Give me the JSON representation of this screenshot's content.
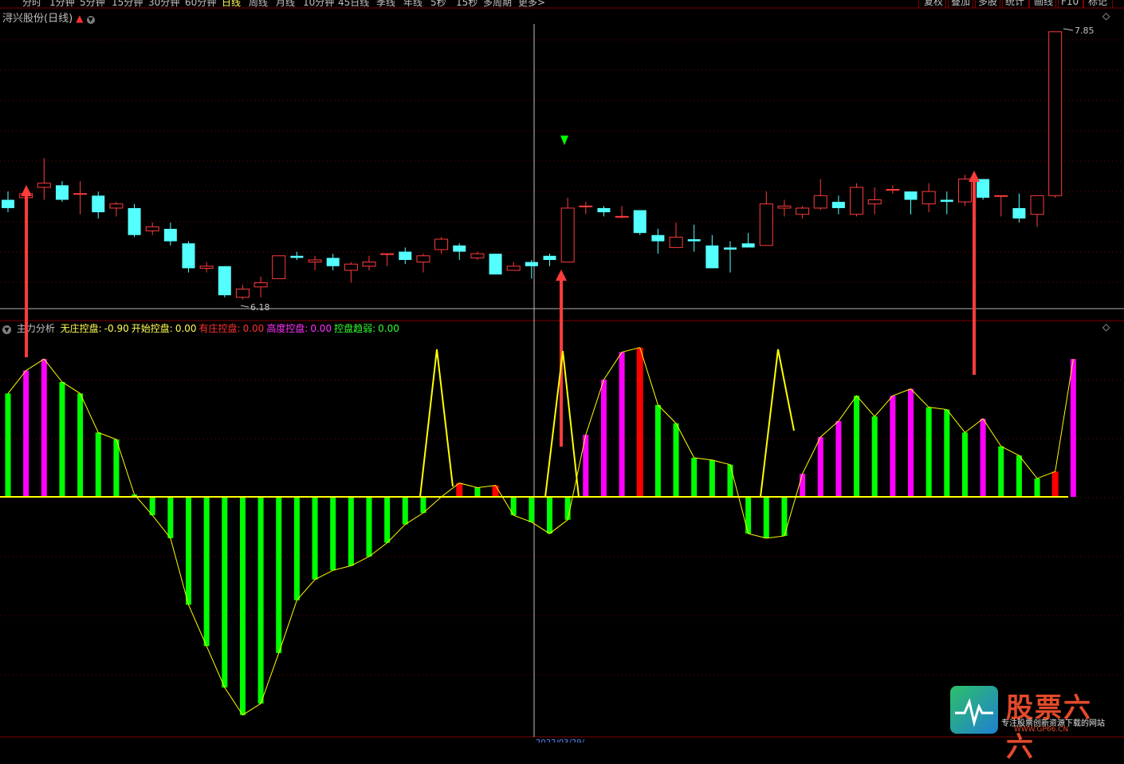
{
  "toolbar": {
    "periods": [
      "分时",
      "1分钟",
      "5分钟",
      "15分钟",
      "30分钟",
      "60分钟",
      "日线",
      "周线",
      "月线",
      "10分钟",
      "45日线",
      "季线",
      "年线",
      "5秒",
      "15秒",
      "多周期",
      "更多>"
    ],
    "active_period": "日线",
    "right_buttons": [
      "复权",
      "叠加",
      "多股",
      "统计",
      "画线",
      "F10",
      "标记"
    ]
  },
  "stock": {
    "title": "浔兴股份(日线)"
  },
  "price_labels": {
    "high": "7.85",
    "low": "6.18"
  },
  "indicator": {
    "name": "主力分析",
    "items": [
      {
        "label": "无庄控盘:",
        "value": "-0.90",
        "color": "#ffff54"
      },
      {
        "label": "开始控盘:",
        "value": "0.00",
        "color": "#ffff54"
      },
      {
        "label": "有庄控盘:",
        "value": "0.00",
        "color": "#ff3030"
      },
      {
        "label": "高度控盘:",
        "value": "0.00",
        "color": "#ff30ff"
      },
      {
        "label": "控盘趋弱:",
        "value": "0.00",
        "color": "#30ff30"
      }
    ]
  },
  "footer": {
    "date_label": "2022/03/29/"
  },
  "watermark": {
    "brand": "股票六六",
    "slogan": "专注股票创新资源下载的网站",
    "url": "WWW.GP66.CN"
  },
  "colors": {
    "up": "#ff3c3c",
    "down": "#54ffff",
    "green": "#00ff00",
    "magenta": "#ff00ff",
    "red_bar": "#ff0000",
    "yellow": "#ffff00"
  },
  "chart_data": [
    {
      "type": "candlestick",
      "ohlc": [
        [
          7.04,
          7.08,
          6.98,
          7.0
        ],
        [
          7.05,
          7.09,
          6.98,
          7.07
        ],
        [
          7.1,
          7.24,
          7.04,
          7.12
        ],
        [
          7.11,
          7.13,
          7.03,
          7.04
        ],
        [
          7.07,
          7.13,
          6.97,
          7.07
        ],
        [
          7.06,
          7.08,
          6.95,
          6.98
        ],
        [
          7.0,
          7.03,
          6.96,
          7.02
        ],
        [
          7.0,
          7.02,
          6.86,
          6.87
        ],
        [
          6.89,
          6.93,
          6.87,
          6.91
        ],
        [
          6.9,
          6.93,
          6.82,
          6.84
        ],
        [
          6.83,
          6.84,
          6.69,
          6.71
        ],
        [
          6.71,
          6.74,
          6.69,
          6.72
        ],
        [
          6.72,
          6.72,
          6.57,
          6.58
        ],
        [
          6.57,
          6.63,
          6.56,
          6.61
        ],
        [
          6.62,
          6.67,
          6.57,
          6.64
        ],
        [
          6.66,
          6.77,
          6.66,
          6.77
        ],
        [
          6.77,
          6.79,
          6.75,
          6.76
        ],
        [
          6.74,
          6.77,
          6.7,
          6.75
        ],
        [
          6.76,
          6.78,
          6.7,
          6.72
        ],
        [
          6.7,
          6.74,
          6.64,
          6.73
        ],
        [
          6.72,
          6.77,
          6.7,
          6.74
        ],
        [
          6.78,
          6.78,
          6.72,
          6.78
        ],
        [
          6.79,
          6.81,
          6.73,
          6.75
        ],
        [
          6.74,
          6.78,
          6.69,
          6.77
        ],
        [
          6.8,
          6.86,
          6.78,
          6.85
        ],
        [
          6.82,
          6.83,
          6.75,
          6.79
        ],
        [
          6.76,
          6.79,
          6.75,
          6.78
        ],
        [
          6.78,
          6.78,
          6.68,
          6.68
        ],
        [
          6.7,
          6.74,
          6.7,
          6.72
        ],
        [
          6.74,
          6.75,
          6.66,
          6.72
        ],
        [
          6.77,
          6.78,
          6.72,
          6.75
        ],
        [
          6.74,
          7.05,
          6.74,
          7.0
        ],
        [
          7.01,
          7.03,
          6.97,
          7.01
        ],
        [
          7.0,
          7.01,
          6.96,
          6.98
        ],
        [
          6.96,
          7.01,
          6.95,
          6.96
        ],
        [
          6.99,
          6.99,
          6.87,
          6.88
        ],
        [
          6.87,
          6.9,
          6.78,
          6.84
        ],
        [
          6.81,
          6.93,
          6.81,
          6.86
        ],
        [
          6.85,
          6.92,
          6.79,
          6.84
        ],
        [
          6.82,
          6.87,
          6.71,
          6.71
        ],
        [
          6.81,
          6.84,
          6.69,
          6.8
        ],
        [
          6.83,
          6.88,
          6.82,
          6.81
        ],
        [
          6.82,
          7.08,
          6.82,
          7.02
        ],
        [
          7.0,
          7.04,
          6.96,
          7.01
        ],
        [
          6.97,
          7.01,
          6.95,
          7.0
        ],
        [
          7.0,
          7.14,
          6.99,
          7.06
        ],
        [
          7.03,
          7.06,
          6.97,
          7.0
        ],
        [
          6.97,
          7.12,
          6.96,
          7.1
        ],
        [
          7.02,
          7.1,
          6.97,
          7.04
        ],
        [
          7.09,
          7.11,
          7.07,
          7.09
        ],
        [
          7.08,
          7.08,
          6.97,
          7.04
        ],
        [
          7.02,
          7.12,
          6.98,
          7.08
        ],
        [
          7.04,
          7.08,
          6.97,
          7.03
        ],
        [
          7.03,
          7.16,
          7.01,
          7.14
        ],
        [
          7.14,
          7.14,
          7.04,
          7.05
        ],
        [
          7.06,
          7.06,
          6.96,
          7.06
        ],
        [
          7.0,
          7.07,
          6.93,
          6.95
        ],
        [
          6.97,
          7.02,
          6.91,
          7.06
        ],
        [
          7.06,
          7.85,
          7.05,
          7.85
        ]
      ],
      "low_marker": 6.18,
      "high_marker": 7.85
    },
    {
      "type": "bar",
      "title": "主力分析",
      "values": [
        0.45,
        0.55,
        0.6,
        0.5,
        0.45,
        0.28,
        0.25,
        0.01,
        -0.08,
        -0.18,
        -0.47,
        -0.65,
        -0.83,
        -0.95,
        -0.9,
        -0.68,
        -0.45,
        -0.36,
        -0.32,
        -0.3,
        -0.26,
        -0.2,
        -0.12,
        -0.07,
        0.0,
        0.06,
        0.04,
        0.05,
        -0.08,
        -0.11,
        -0.16,
        -0.1,
        0.27,
        0.51,
        0.63,
        0.65,
        0.4,
        0.32,
        0.17,
        0.16,
        0.14,
        -0.16,
        -0.18,
        -0.17,
        0.1,
        0.26,
        0.33,
        0.44,
        0.35,
        0.44,
        0.47,
        0.39,
        0.38,
        0.28,
        0.34,
        0.22,
        0.18,
        0.08,
        0.11,
        0.6
      ],
      "colors": [
        "g",
        "m",
        "m",
        "g",
        "g",
        "g",
        "g",
        "g",
        "g",
        "g",
        "g",
        "g",
        "g",
        "g",
        "g",
        "g",
        "g",
        "g",
        "g",
        "g",
        "g",
        "g",
        "g",
        "g",
        "g",
        "r",
        "g",
        "r",
        "g",
        "g",
        "g",
        "g",
        "m",
        "m",
        "m",
        "r",
        "g",
        "g",
        "g",
        "g",
        "g",
        "g",
        "g",
        "g",
        "m",
        "m",
        "m",
        "g",
        "g",
        "m",
        "m",
        "g",
        "g",
        "g",
        "m",
        "g",
        "g",
        "g",
        "r",
        "m"
      ]
    }
  ]
}
